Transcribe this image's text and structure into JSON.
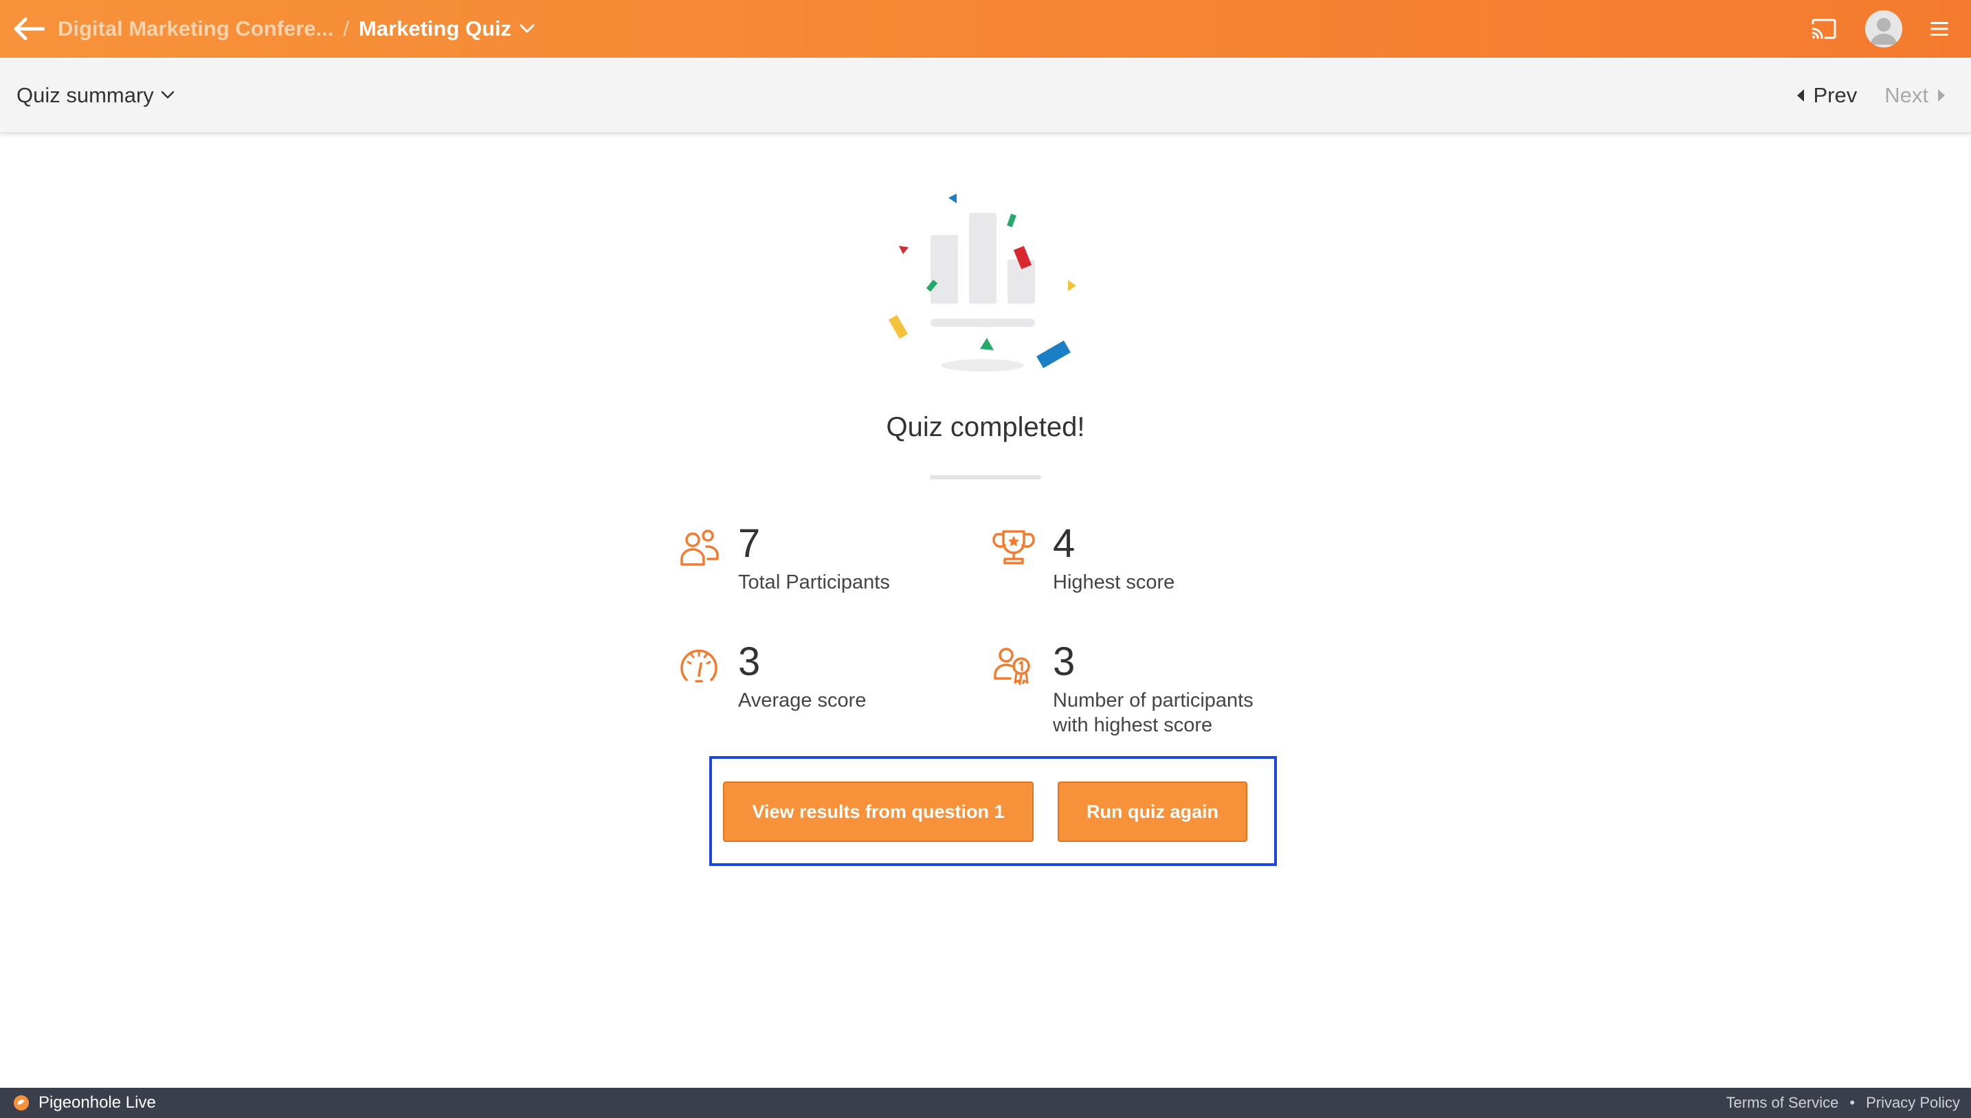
{
  "header": {
    "event_title": "Digital Marketing Confere...",
    "separator": "/",
    "current_page": "Marketing Quiz"
  },
  "subheader": {
    "view_selector": "Quiz summary",
    "prev_label": "Prev",
    "next_label": "Next"
  },
  "summary": {
    "title": "Quiz completed!",
    "stats": [
      {
        "icon": "participants-icon",
        "value": "7",
        "label": "Total Participants"
      },
      {
        "icon": "trophy-icon",
        "value": "4",
        "label": "Highest score"
      },
      {
        "icon": "speedometer-icon",
        "value": "3",
        "label": "Average score"
      },
      {
        "icon": "top-participants-icon",
        "value": "3",
        "label_line1": "Number of participants",
        "label_line2": "with highest score"
      }
    ],
    "actions": {
      "view_results_label": "View results from question 1",
      "run_again_label": "Run quiz again"
    }
  },
  "footer": {
    "brand": "Pigeonhole Live",
    "terms": "Terms of Service",
    "bullet": "•",
    "privacy": "Privacy Policy"
  },
  "colors": {
    "brand_orange": "#f7923a",
    "highlight_blue": "#1a44e3",
    "footer_bg": "#3b3f4c"
  }
}
